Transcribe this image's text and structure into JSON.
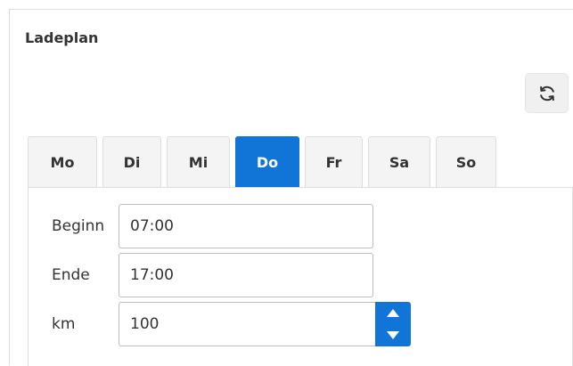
{
  "panel": {
    "title": "Ladeplan",
    "refresh_icon": "refresh-icon"
  },
  "tabs": [
    {
      "label": "Mo",
      "active": false
    },
    {
      "label": "Di",
      "active": false
    },
    {
      "label": "Mi",
      "active": false
    },
    {
      "label": "Do",
      "active": true
    },
    {
      "label": "Fr",
      "active": false
    },
    {
      "label": "Sa",
      "active": false
    },
    {
      "label": "So",
      "active": false
    }
  ],
  "form": {
    "begin_label": "Beginn",
    "begin_value": "07:00",
    "end_label": "Ende",
    "end_value": "17:00",
    "km_label": "km",
    "km_value": "100"
  },
  "colors": {
    "accent": "#1175d8",
    "tab_bg": "#f4f4f4",
    "border": "#dddddd"
  }
}
